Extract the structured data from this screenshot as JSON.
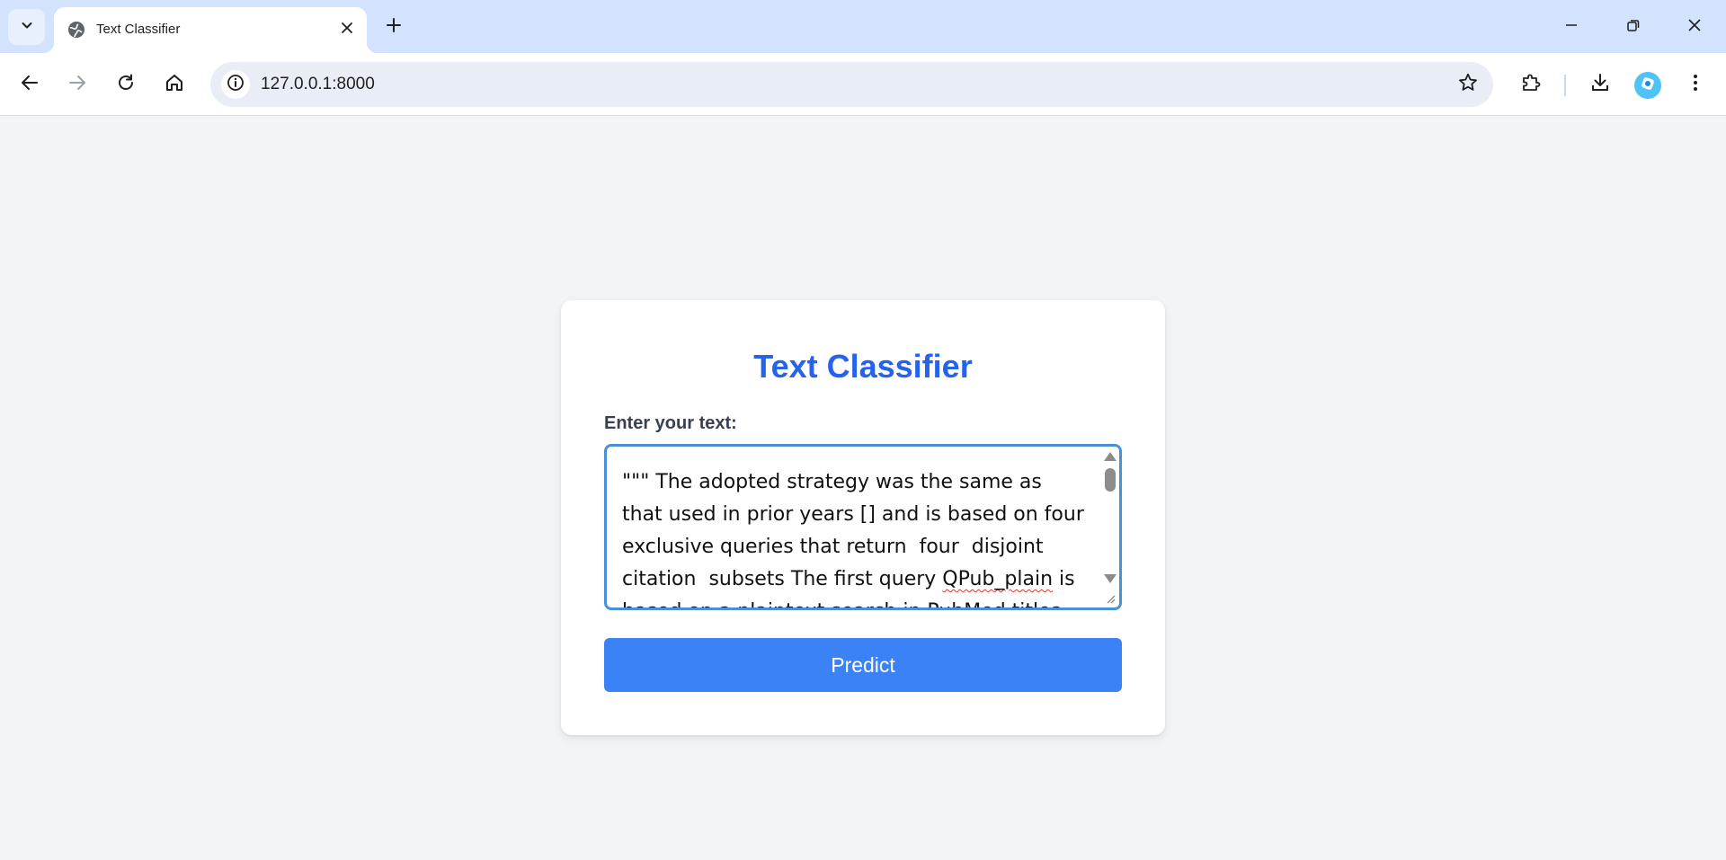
{
  "browser": {
    "tab": {
      "title": "Text Classifier"
    },
    "address_bar": {
      "url": "127.0.0.1:8000"
    },
    "icons": {
      "tab_search": "chevron-down-icon",
      "favicon": "globe-icon",
      "tab_close": "close-icon",
      "new_tab": "plus-icon",
      "minimize": "minimize-icon",
      "restore": "restore-icon",
      "close_window": "close-icon",
      "back": "arrow-left-icon",
      "forward": "arrow-right-icon",
      "reload": "reload-icon",
      "home": "home-icon",
      "site_info": "info-icon",
      "bookmark": "star-icon",
      "extensions": "puzzle-icon",
      "downloads": "download-icon",
      "profile": "profile-avatar-icon",
      "menu": "more-vertical-icon"
    }
  },
  "page": {
    "title": "Text Classifier",
    "input_label": "Enter your text:",
    "textarea": {
      "part1": "\"\"\" The adopted strategy was the same as that used in prior years [] and is based on four exclusive queries that return  four  disjoint citation  subsets The first query ",
      "squiggle": "QPub_plain",
      "part2": " is based on a plaintext search in PubMed titles and"
    },
    "predict_button": "Predict"
  },
  "colors": {
    "tabstrip": "#d3e3fd",
    "accent_title": "#2563eb",
    "button": "#3b82f6",
    "page_background": "#f3f4f6",
    "textarea_focus_border": "#4a90d9"
  }
}
